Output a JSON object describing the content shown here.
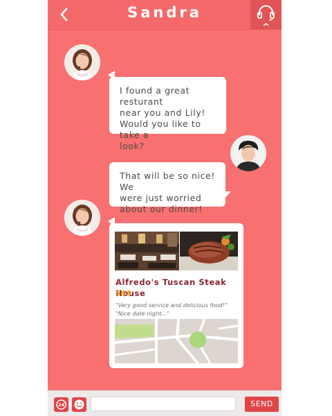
{
  "header": {
    "title": "Sandra",
    "back_icon": "chevron-left-icon",
    "support_icon": "headset-icon"
  },
  "messages": [
    {
      "from": "agent",
      "text": "I found a great resturant\nnear you and Lily!\nWould you like to take a\nlook?"
    },
    {
      "from": "user",
      "text": "That will be so nice! We\nwere just worried\nabout our dinner!"
    }
  ],
  "restaurant_card": {
    "name": "Alfredo's Tuscan Steak House",
    "price": "$$$",
    "reviews": [
      "\"Very good service and delicious food!\"",
      "\"Nice date night...\""
    ]
  },
  "footer": {
    "clock_icon": "24-hour-icon",
    "emoji_icon": "smiley-icon",
    "input_value": "",
    "input_placeholder": "",
    "send_label": "SEND"
  },
  "colors": {
    "background": "#f8706f",
    "accent": "#e04547",
    "restaurant_name": "#8a2430",
    "price": "#f3a61f"
  }
}
